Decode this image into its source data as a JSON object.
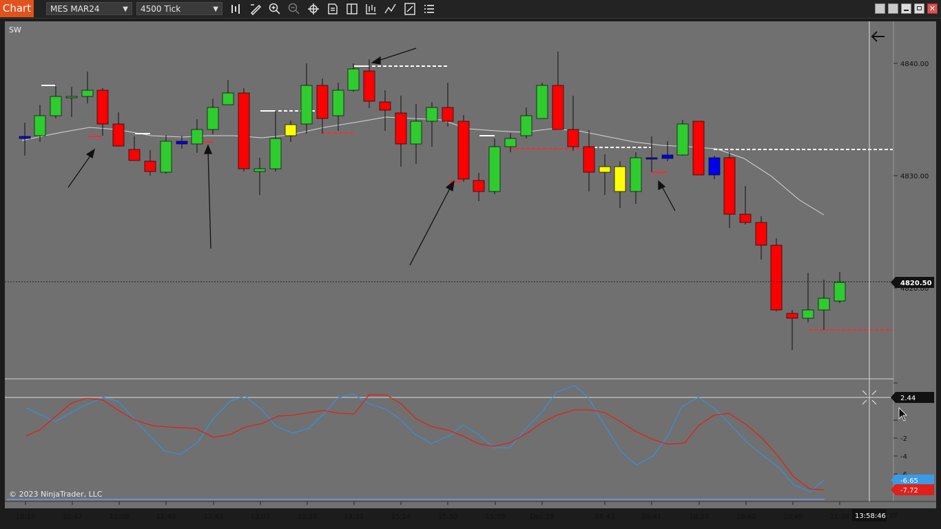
{
  "toolbar": {
    "chart_tab": "Chart",
    "instrument": "MES MAR24",
    "interval": "4500 Tick",
    "tools": [
      "bars-type-icon",
      "draw-pencil-icon",
      "zoom-in-icon",
      "zoom-out-icon",
      "crosshair-icon",
      "data-box-icon",
      "chart-trader-icon",
      "strategy-icon",
      "indicators-icon",
      "properties-icon",
      "list-icon"
    ],
    "window_buttons": [
      "tile-icon",
      "tile2-icon",
      "minimize-icon",
      "restore-icon",
      "close-icon"
    ]
  },
  "chart": {
    "indicator_label": "SW",
    "copyright": "© 2023 NinjaTrader, LLC",
    "price_axis": [
      "4840.00",
      "4830.00",
      "4820.00"
    ],
    "last_price": "4820.50",
    "osc_axis": [
      "-2",
      "-4",
      "-6"
    ],
    "osc_marker": "2.44",
    "osc_blue_value": "-6.65",
    "osc_red_value": "-7.72",
    "time_axis": [
      "10:15",
      "10:47",
      "11:08",
      "11:40",
      "12:43",
      "13:07",
      "13:38",
      "14:31",
      "15:14",
      "15:50",
      "15:59",
      "Dec 29",
      "08:43",
      "09:41",
      "10:15",
      "10:40",
      "10:49",
      "11:04"
    ],
    "crosshair_time": "13:58:46",
    "time_axis_tail": "37",
    "colors": {
      "up": "#2ecc2e",
      "down": "#ff0000",
      "neutral_blue": "#0000ee",
      "neutral_yellow": "#ffff00",
      "background": "#707070",
      "osc_blue": "#3a8fd8",
      "osc_red": "#e0201a"
    }
  }
}
